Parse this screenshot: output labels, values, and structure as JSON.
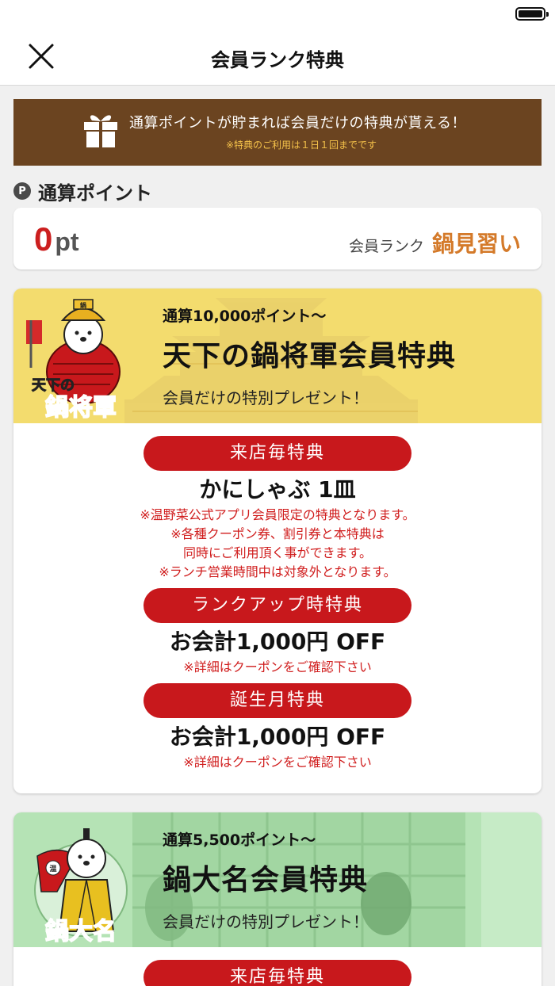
{
  "nav": {
    "title": "会員ランク特典"
  },
  "banner": {
    "main": "通算ポイントが貯まれば会員だけの特典が貰える！",
    "note": "※特典のご利用は１日１回までです"
  },
  "points": {
    "section_label": "通算ポイント",
    "badge": "P",
    "value": "0",
    "unit": "pt",
    "rank_label": "会員ランク",
    "rank_value": "鍋見習い"
  },
  "tiers": [
    {
      "mascot_text_line1": "天下の",
      "mascot_text_line2": "鍋将軍",
      "requirement": "通算10,000ポイント〜",
      "title": "天下の鍋将軍会員特典",
      "subtitle": "会員だけの特別プレゼント！",
      "header_color": "#f3dc6e",
      "benefits": [
        {
          "label": "来店毎特典",
          "value": "かにしゃぶ 1皿",
          "notes": [
            "※温野菜公式アプリ会員限定の特典となります。",
            "※各種クーポン券、割引券と本特典は",
            "同時にご利用頂く事ができます。",
            "※ランチ営業時間中は対象外となります。"
          ]
        },
        {
          "label": "ランクアップ時特典",
          "value": "お会計1,000円 OFF",
          "notes": [
            "※詳細はクーポンをご確認下さい"
          ]
        },
        {
          "label": "誕生月特典",
          "value": "お会計1,000円 OFF",
          "notes": [
            "※詳細はクーポンをご確認下さい"
          ]
        }
      ]
    },
    {
      "mascot_text_line1": "鍋大名",
      "requirement": "通算5,500ポイント〜",
      "title": "鍋大名会員特典",
      "subtitle": "会員だけの特別プレゼント！",
      "header_color": "#b5e3b5",
      "benefits": [
        {
          "label": "来店毎特典"
        }
      ]
    }
  ],
  "colors": {
    "accent_red": "#c8181c",
    "banner_brown": "#6b4420",
    "rank_orange": "#d47a2a",
    "note_red": "#d01d1d",
    "banner_note_yellow": "#f5c24a"
  },
  "icons": [
    "battery-icon",
    "close-icon",
    "gift-icon",
    "point-badge-icon",
    "shogun-mascot",
    "daimyo-mascot"
  ]
}
